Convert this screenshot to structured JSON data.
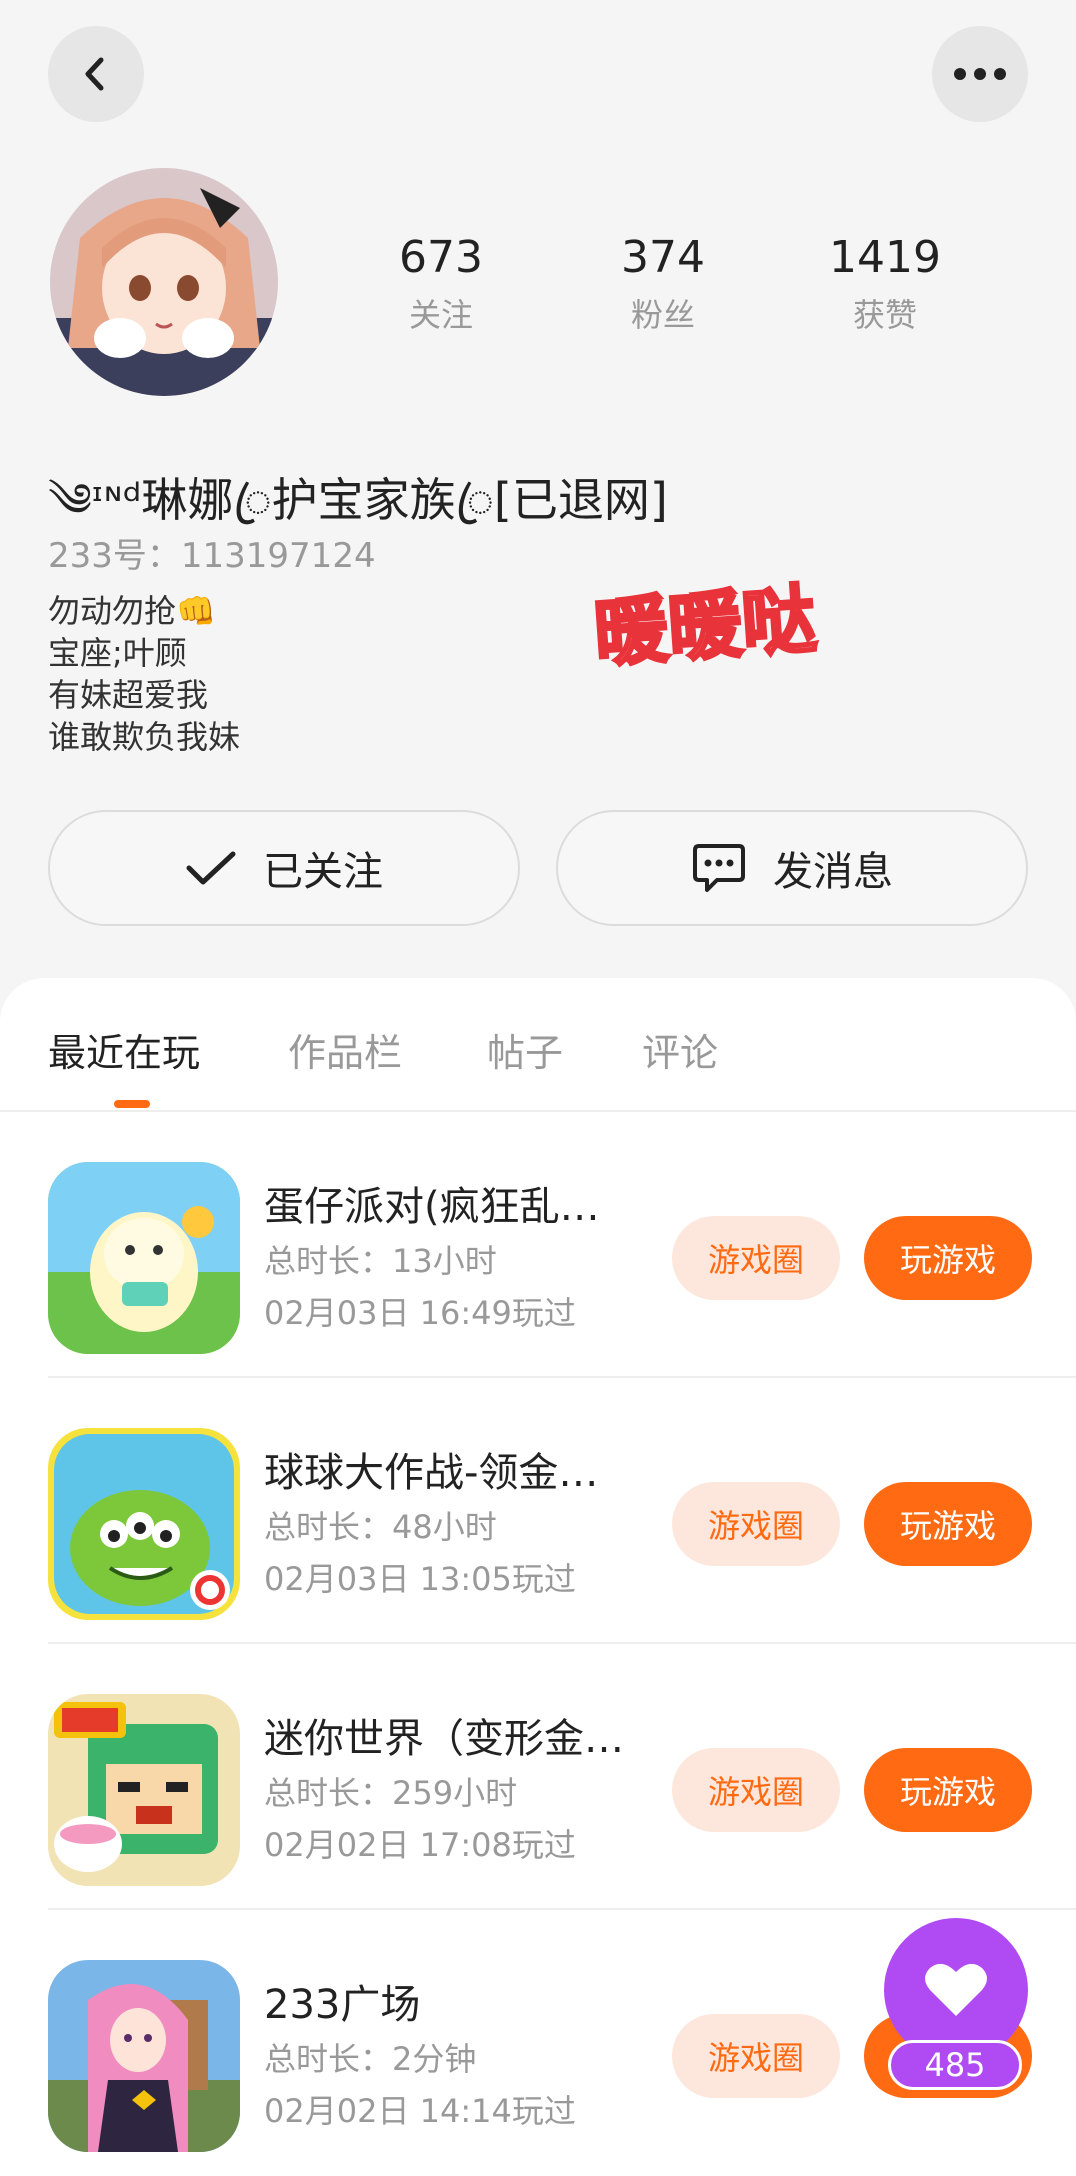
{
  "header": {
    "back_icon": "chevron-left-icon",
    "more_icon": "more-horizontal-icon"
  },
  "profile": {
    "stats": [
      {
        "value": "673",
        "label": "关注"
      },
      {
        "value": "374",
        "label": "粉丝"
      },
      {
        "value": "1419",
        "label": "获赞"
      }
    ],
    "nickname": "༄ᶦᶰᵈ琳娜ꦿ护宝家族ꦿ[已退网]",
    "uid": "233号：113197124",
    "bio": [
      "勿动勿抢👊",
      "宝座;叶顾",
      "有妹超爱我",
      "谁敢欺负我妹"
    ],
    "decoration_text": "暖暖哒"
  },
  "actions": {
    "follow_label": "已关注",
    "message_label": "发消息"
  },
  "tabs": [
    "最近在玩",
    "作品栏",
    "帖子",
    "评论"
  ],
  "games": [
    {
      "title": "蛋仔派对(疯狂乱…",
      "duration": "总时长：13小时",
      "last_played": "02月03日 16:49玩过",
      "circle_label": "游戏圈",
      "play_label": "玩游戏"
    },
    {
      "title": "球球大作战-领金…",
      "duration": "总时长：48小时",
      "last_played": "02月03日 13:05玩过",
      "circle_label": "游戏圈",
      "play_label": "玩游戏"
    },
    {
      "title": "迷你世界（变形金…",
      "duration": "总时长：259小时",
      "last_played": "02月02日 17:08玩过",
      "circle_label": "游戏圈",
      "play_label": "玩游戏"
    },
    {
      "title": "233广场",
      "duration": "总时长：2分钟",
      "last_played": "02月02日 14:14玩过",
      "circle_label": "游戏圈",
      "play_label": "玩游戏"
    }
  ],
  "like_fab": {
    "icon": "heart-icon",
    "count": "485"
  },
  "colors": {
    "accent": "#ff6a13",
    "accent_soft": "#fde7dc",
    "fab": "#b04bf4"
  }
}
